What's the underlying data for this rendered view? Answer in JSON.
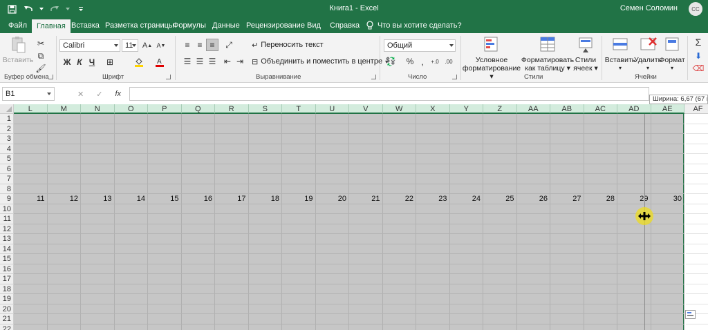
{
  "title_bar": {
    "title": "Книга1  -  Excel",
    "user_name": "Семен Соломин",
    "avatar_initials": "СС",
    "qat": [
      "save-icon",
      "undo-icon",
      "redo-icon",
      "customize-icon"
    ]
  },
  "tabs": [
    "Файл",
    "Главная",
    "Вставка",
    "Разметка страницы",
    "Формулы",
    "Данные",
    "Рецензирование",
    "Вид",
    "Справка"
  ],
  "tell_me": "Что вы хотите сделать?",
  "ribbon": {
    "clipboard": {
      "paste": "Вставить",
      "label": "Буфер обмена"
    },
    "font": {
      "name": "Calibri",
      "size": "11",
      "bold": "Ж",
      "italic": "К",
      "underline": "Ч",
      "label": "Шрифт"
    },
    "alignment": {
      "wrap": "Переносить текст",
      "merge": "Объединить и поместить в центре",
      "label": "Выравнивание"
    },
    "number": {
      "format": "Общий",
      "label": "Число"
    },
    "styles": {
      "conditional_l1": "Условное",
      "conditional_l2": "форматирование",
      "as_table_l1": "Форматировать",
      "as_table_l2": "как таблицу",
      "cell_styles_l1": "Стили",
      "cell_styles_l2": "ячеек",
      "label": "Стили"
    },
    "cells": {
      "insert": "Вставить",
      "delete": "Удалить",
      "format": "Формат",
      "label": "Ячейки"
    }
  },
  "formula_bar": {
    "name_box": "B1",
    "fx": "fx",
    "value": ""
  },
  "tooltip": "Ширина: 6,67 (67 пи",
  "columns": [
    "L",
    "M",
    "N",
    "O",
    "P",
    "Q",
    "R",
    "S",
    "T",
    "U",
    "V",
    "W",
    "X",
    "Y",
    "Z",
    "AA",
    "AB",
    "AC",
    "AD",
    "AE",
    "AF"
  ],
  "rows": [
    "1",
    "2",
    "3",
    "4",
    "5",
    "6",
    "7",
    "8",
    "9",
    "10",
    "11",
    "12",
    "13",
    "14",
    "15",
    "16",
    "17",
    "18",
    "19",
    "20",
    "21",
    "22"
  ],
  "row9_values": [
    "11",
    "12",
    "13",
    "14",
    "15",
    "16",
    "17",
    "18",
    "19",
    "20",
    "21",
    "22",
    "23",
    "24",
    "25",
    "26",
    "27",
    "28",
    "29",
    "30"
  ],
  "colors": {
    "accent": "#217346",
    "selection": "#c6c6c6",
    "header_selected": "#d3ecdd"
  }
}
